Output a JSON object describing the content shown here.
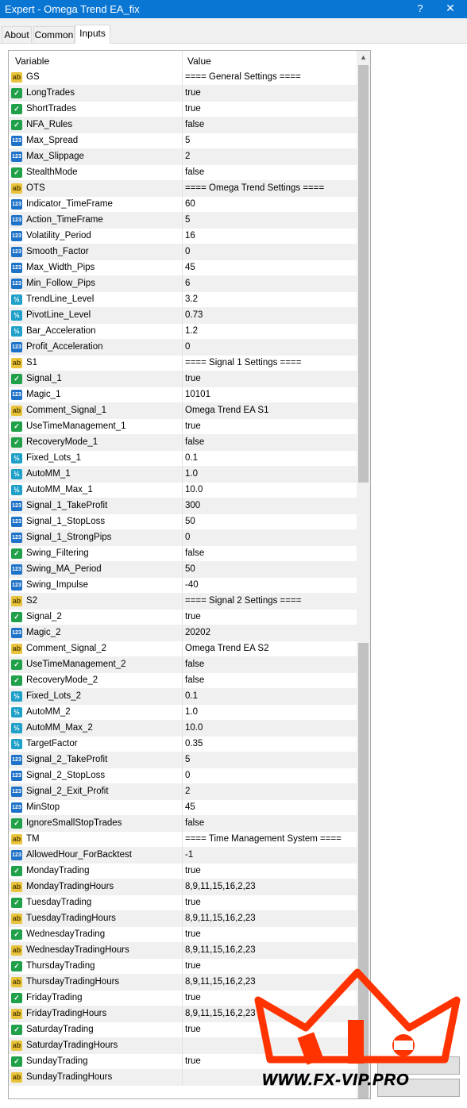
{
  "window": {
    "title": "Expert - Omega Trend EA_fix",
    "help": "?",
    "close": "✕"
  },
  "tabs": [
    {
      "label": "About"
    },
    {
      "label": "Common"
    },
    {
      "label": "Inputs"
    }
  ],
  "grid": {
    "col_variable": "Variable",
    "col_value": "Value"
  },
  "rows": [
    {
      "icon": "ab",
      "name": "GS",
      "value": "==== General Settings ===="
    },
    {
      "icon": "bool",
      "name": "LongTrades",
      "value": "true"
    },
    {
      "icon": "bool",
      "name": "ShortTrades",
      "value": "true"
    },
    {
      "icon": "bool",
      "name": "NFA_Rules",
      "value": "false"
    },
    {
      "icon": "int",
      "name": "Max_Spread",
      "value": "5"
    },
    {
      "icon": "int",
      "name": "Max_Slippage",
      "value": "2"
    },
    {
      "icon": "bool",
      "name": "StealthMode",
      "value": "false"
    },
    {
      "icon": "ab",
      "name": "OTS",
      "value": "==== Omega Trend Settings ===="
    },
    {
      "icon": "int",
      "name": "Indicator_TimeFrame",
      "value": "60"
    },
    {
      "icon": "int",
      "name": "Action_TimeFrame",
      "value": "5"
    },
    {
      "icon": "int",
      "name": "Volatility_Period",
      "value": "16"
    },
    {
      "icon": "int",
      "name": "Smooth_Factor",
      "value": "0"
    },
    {
      "icon": "int",
      "name": "Max_Width_Pips",
      "value": "45"
    },
    {
      "icon": "int",
      "name": "Min_Follow_Pips",
      "value": "6"
    },
    {
      "icon": "dbl",
      "name": "TrendLine_Level",
      "value": "3.2"
    },
    {
      "icon": "dbl",
      "name": "PivotLine_Level",
      "value": "0.73"
    },
    {
      "icon": "dbl",
      "name": "Bar_Acceleration",
      "value": "1.2"
    },
    {
      "icon": "int",
      "name": "Profit_Acceleration",
      "value": "0"
    },
    {
      "icon": "ab",
      "name": "S1",
      "value": "==== Signal 1 Settings ===="
    },
    {
      "icon": "bool",
      "name": "Signal_1",
      "value": "true"
    },
    {
      "icon": "int",
      "name": "Magic_1",
      "value": "10101"
    },
    {
      "icon": "ab",
      "name": "Comment_Signal_1",
      "value": "Omega Trend EA S1"
    },
    {
      "icon": "bool",
      "name": "UseTimeManagement_1",
      "value": "true"
    },
    {
      "icon": "bool",
      "name": "RecoveryMode_1",
      "value": "false"
    },
    {
      "icon": "dbl",
      "name": "Fixed_Lots_1",
      "value": "0.1"
    },
    {
      "icon": "dbl",
      "name": "AutoMM_1",
      "value": "1.0"
    },
    {
      "icon": "dbl",
      "name": "AutoMM_Max_1",
      "value": "10.0"
    },
    {
      "icon": "int",
      "name": "Signal_1_TakeProfit",
      "value": "300"
    },
    {
      "icon": "int",
      "name": "Signal_1_StopLoss",
      "value": "50"
    },
    {
      "icon": "int",
      "name": "Signal_1_StrongPips",
      "value": "0"
    },
    {
      "icon": "bool",
      "name": "Swing_Filtering",
      "value": "false"
    },
    {
      "icon": "int",
      "name": "Swing_MA_Period",
      "value": "50"
    },
    {
      "icon": "int",
      "name": "Swing_Impulse",
      "value": "-40"
    },
    {
      "icon": "ab",
      "name": "S2",
      "value": "==== Signal 2 Settings ===="
    },
    {
      "icon": "bool",
      "name": "Signal_2",
      "value": "true"
    },
    {
      "icon": "int",
      "name": "Magic_2",
      "value": "20202"
    },
    {
      "icon": "ab",
      "name": "Comment_Signal_2",
      "value": "Omega Trend EA S2"
    },
    {
      "icon": "bool",
      "name": "UseTimeManagement_2",
      "value": "false"
    },
    {
      "icon": "bool",
      "name": "RecoveryMode_2",
      "value": "false"
    },
    {
      "icon": "dbl",
      "name": "Fixed_Lots_2",
      "value": "0.1"
    },
    {
      "icon": "dbl",
      "name": "AutoMM_2",
      "value": "1.0"
    },
    {
      "icon": "dbl",
      "name": "AutoMM_Max_2",
      "value": "10.0"
    },
    {
      "icon": "dbl",
      "name": "TargetFactor",
      "value": "0.35"
    },
    {
      "icon": "int",
      "name": "Signal_2_TakeProfit",
      "value": "5"
    },
    {
      "icon": "int",
      "name": "Signal_2_StopLoss",
      "value": "0"
    },
    {
      "icon": "int",
      "name": "Signal_2_Exit_Profit",
      "value": "2"
    },
    {
      "icon": "int",
      "name": "MinStop",
      "value": "45"
    },
    {
      "icon": "bool",
      "name": "IgnoreSmallStopTrades",
      "value": "false"
    },
    {
      "icon": "ab",
      "name": "TM",
      "value": "==== Time Management System ===="
    },
    {
      "icon": "int",
      "name": "AllowedHour_ForBacktest",
      "value": "-1"
    },
    {
      "icon": "bool",
      "name": "MondayTrading",
      "value": "true"
    },
    {
      "icon": "ab",
      "name": "MondayTradingHours",
      "value": "8,9,11,15,16,2,23"
    },
    {
      "icon": "bool",
      "name": "TuesdayTrading",
      "value": "true"
    },
    {
      "icon": "ab",
      "name": "TuesdayTradingHours",
      "value": "8,9,11,15,16,2,23"
    },
    {
      "icon": "bool",
      "name": "WednesdayTrading",
      "value": "true"
    },
    {
      "icon": "ab",
      "name": "WednesdayTradingHours",
      "value": "8,9,11,15,16,2,23"
    },
    {
      "icon": "bool",
      "name": "ThursdayTrading",
      "value": "true"
    },
    {
      "icon": "ab",
      "name": "ThursdayTradingHours",
      "value": "8,9,11,15,16,2,23"
    },
    {
      "icon": "bool",
      "name": "FridayTrading",
      "value": "true"
    },
    {
      "icon": "ab",
      "name": "FridayTradingHours",
      "value": "8,9,11,15,16,2,23"
    },
    {
      "icon": "bool",
      "name": "SaturdayTrading",
      "value": "true"
    },
    {
      "icon": "ab",
      "name": "SaturdayTradingHours",
      "value": ""
    },
    {
      "icon": "bool",
      "name": "SundayTrading",
      "value": "true"
    },
    {
      "icon": "ab",
      "name": "SundayTradingHours",
      "value": ""
    }
  ],
  "icon_glyphs": {
    "ab": "ab",
    "int": "123",
    "dbl": "½",
    "bool": "✓"
  },
  "colors": {
    "titlebar": "#0a76d4",
    "ab_icon": "#e8c33b",
    "int_icon": "#1e72c8",
    "dbl_icon": "#1fa0c8",
    "bool_icon": "#21a04a",
    "watermark": "#ff3300"
  },
  "watermark": {
    "text": "WWW.FX-VIP.PRO"
  }
}
